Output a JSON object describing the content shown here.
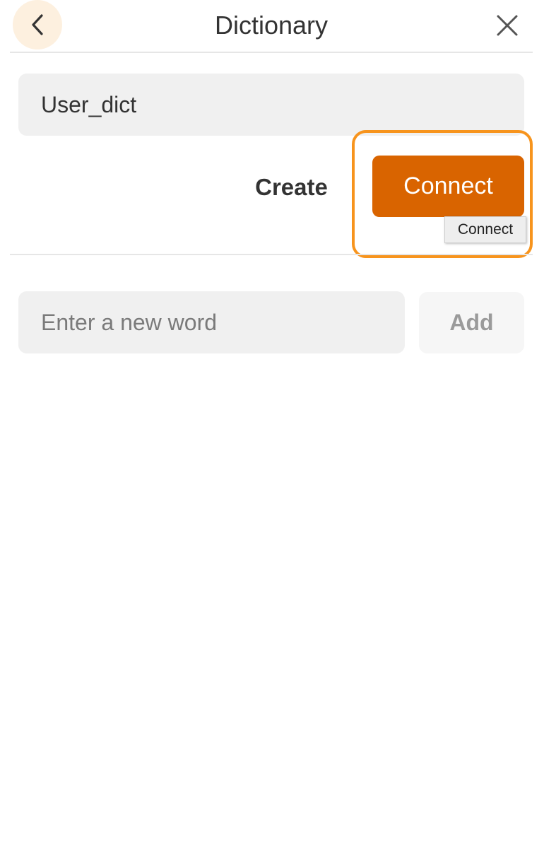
{
  "header": {
    "title": "Dictionary",
    "back_icon": "chevron-left-icon",
    "close_icon": "close-icon"
  },
  "dictionary": {
    "name_value": "User_dict"
  },
  "actions": {
    "create_label": "Create",
    "connect_label": "Connect",
    "connect_tooltip": "Connect"
  },
  "new_word": {
    "placeholder": "Enter a new word",
    "value": "",
    "add_label": "Add"
  },
  "colors": {
    "accent": "#d96400",
    "focus_ring": "#f7941d",
    "back_highlight": "#fdf0df",
    "field_bg": "#f0f0f0"
  }
}
